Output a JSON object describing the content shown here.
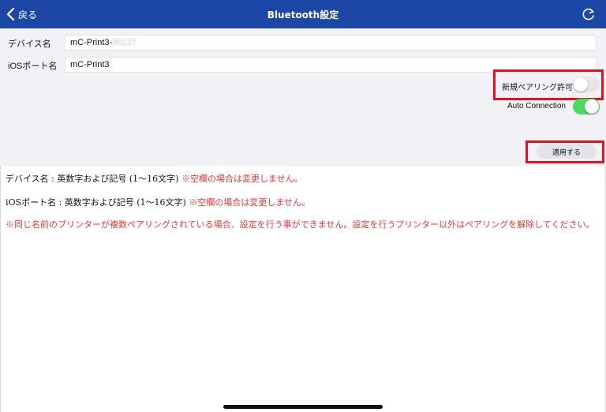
{
  "colors": {
    "navbar": "#1d47a6",
    "highlight": "#e0141e",
    "toggle_on": "#4cd964",
    "warning_text": "#e53935"
  },
  "navbar": {
    "back_label": "戻る",
    "title": "Bluetooth設定",
    "back_icon": "chevron-left-icon",
    "refresh_icon": "refresh-icon"
  },
  "form": {
    "device_name_label": "デバイス名",
    "device_name_value": "mC-Print3-",
    "device_name_blurred_suffix": "00127",
    "ios_port_label": "iOSポート名",
    "ios_port_value": "mC-Print3"
  },
  "toggles": {
    "new_pairing": {
      "label": "新規ペアリング許可",
      "on": false
    },
    "auto_connection": {
      "label": "Auto Connection",
      "on": true
    }
  },
  "apply_button_label": "適用する",
  "info": {
    "device_rule": "デバイス名 : 英数字および記号 (1〜16文字) ",
    "device_note": "※空欄の場合は変更しません。",
    "ios_rule": "iOSポート名 : 英数字および記号 (1〜16文字) ",
    "ios_note": "※空欄の場合は変更しません。",
    "duplicate_warning": "※同じ名前のプリンターが複数ペアリングされている場合、設定を行う事ができません。設定を行うプリンター以外はペアリングを解除してください。"
  }
}
